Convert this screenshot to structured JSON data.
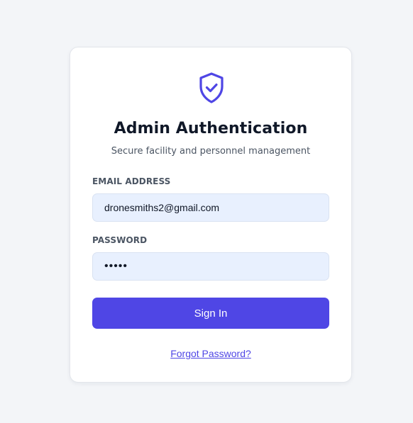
{
  "colors": {
    "accent": "#4f46e5",
    "background": "#f3f5f8",
    "input_fill": "#e8f0fe"
  },
  "login": {
    "icon": "shield-check-icon",
    "title": "Admin Authentication",
    "subtitle": "Secure facility and personnel management",
    "email_label": "EMAIL ADDRESS",
    "email_value": "dronesmiths2@gmail.com",
    "password_label": "PASSWORD",
    "password_value": "12345",
    "submit_label": "Sign In",
    "forgot_label": "Forgot Password?"
  }
}
